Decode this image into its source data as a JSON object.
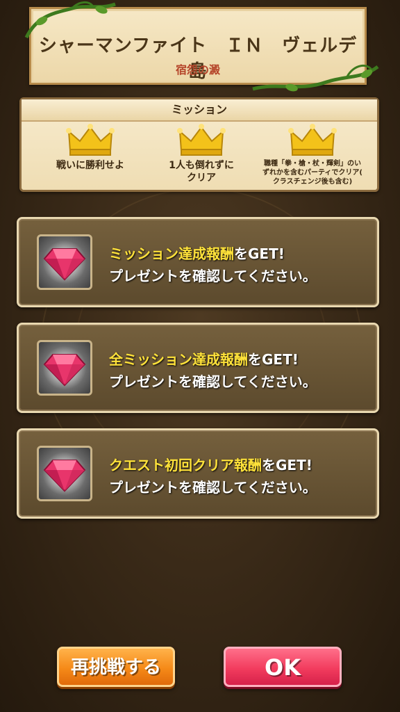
{
  "title": {
    "main": "シャーマンファイト　ＩＮ　ヴェルデ島",
    "sub": "宿怨の澱"
  },
  "missions": {
    "header": "ミッション",
    "items": [
      {
        "text": "戦いに勝利せよ",
        "icon": "crown-icon"
      },
      {
        "text": "1人も倒れずに\nクリア",
        "icon": "crown-icon"
      },
      {
        "text": "職種「拳・槍・杖・輝剣」のい\nずれかを含むパーティでクリア(\nクラスチェンジ後も含む)",
        "icon": "crown-icon"
      }
    ]
  },
  "rewards": [
    {
      "highlight": "ミッション達成報酬",
      "suffix": "をGET!",
      "line2": "プレゼントを確認してください。",
      "icon": "gem-icon"
    },
    {
      "highlight": "全ミッション達成報酬",
      "suffix": "をGET!",
      "line2": "プレゼントを確認してください。",
      "icon": "gem-icon"
    },
    {
      "highlight": "クエスト初回クリア報酬",
      "suffix": "をGET!",
      "line2": "プレゼントを確認してください。",
      "icon": "gem-icon"
    }
  ],
  "buttons": {
    "retry": "再挑戦する",
    "ok": "OK"
  },
  "colors": {
    "highlight_text": "#ffe23a",
    "retry_button": "#f58a18",
    "ok_button": "#f23c5e"
  }
}
